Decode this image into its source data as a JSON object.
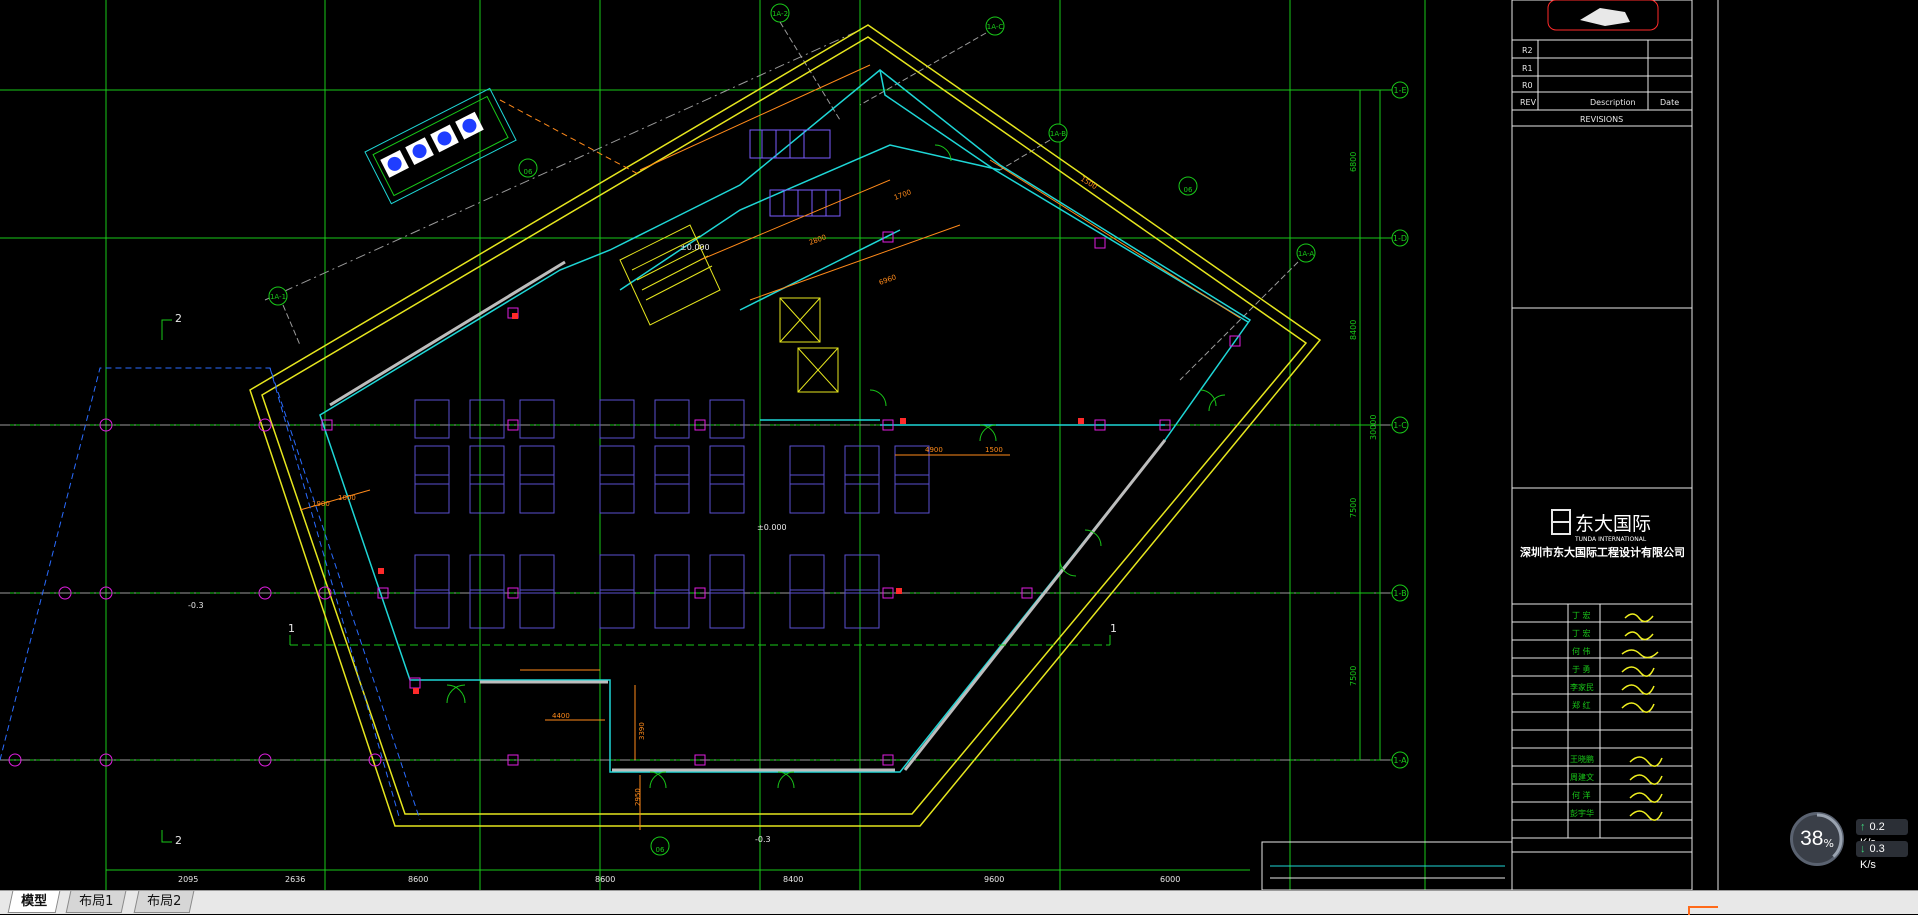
{
  "drawing": {
    "grid_right_labels": [
      "1-E",
      "1-D",
      "1-C",
      "1-B",
      "1-A"
    ],
    "grid_angled_labels": [
      "1A-2",
      "1A-C",
      "1A-B",
      "1A-A",
      "1A-1"
    ],
    "section_marks": [
      "2",
      "2",
      "1",
      "1"
    ],
    "bottom_dimensions": [
      "2095",
      "2636",
      "8600",
      "8600",
      "8400",
      "9600",
      "6000"
    ],
    "right_dimensions": [
      "6800",
      "8400",
      "30000",
      "7500",
      "7500"
    ],
    "inner_dimensions": [
      "4900",
      "1500",
      "4400",
      "3390",
      "2950",
      "1900",
      "1000",
      "6960",
      "1700",
      "2800",
      "1500"
    ],
    "levels": [
      "±0.000",
      "±0.000",
      "-0.3",
      "-0.3"
    ],
    "detail_refs": [
      "06",
      "06",
      "06"
    ]
  },
  "title_block": {
    "revision_rows": [
      "R2",
      "R1",
      "R0"
    ],
    "rev_header": [
      "REV",
      "Description",
      "Date"
    ],
    "revisions_label": "REVISIONS",
    "company_logo_text": "东大国际",
    "company_logo_sub": "TUNDA INTERNATIONAL",
    "company_name": "深圳市东大国际工程设计有限公司",
    "signature_names": [
      "丁 宏",
      "丁 宏",
      "何 伟",
      "于 勇",
      "李家民",
      "郑 红",
      "王晓鹏",
      "周建文",
      "何 洋",
      "彭宇华"
    ]
  },
  "tabs": [
    "模型",
    "布局1",
    "布局2"
  ],
  "network": {
    "percent": "38",
    "percent_unit": "%",
    "percent_value": 0.38,
    "up": "0.2",
    "up_unit": "K/s",
    "down": "0.3",
    "down_unit": "K/s"
  }
}
